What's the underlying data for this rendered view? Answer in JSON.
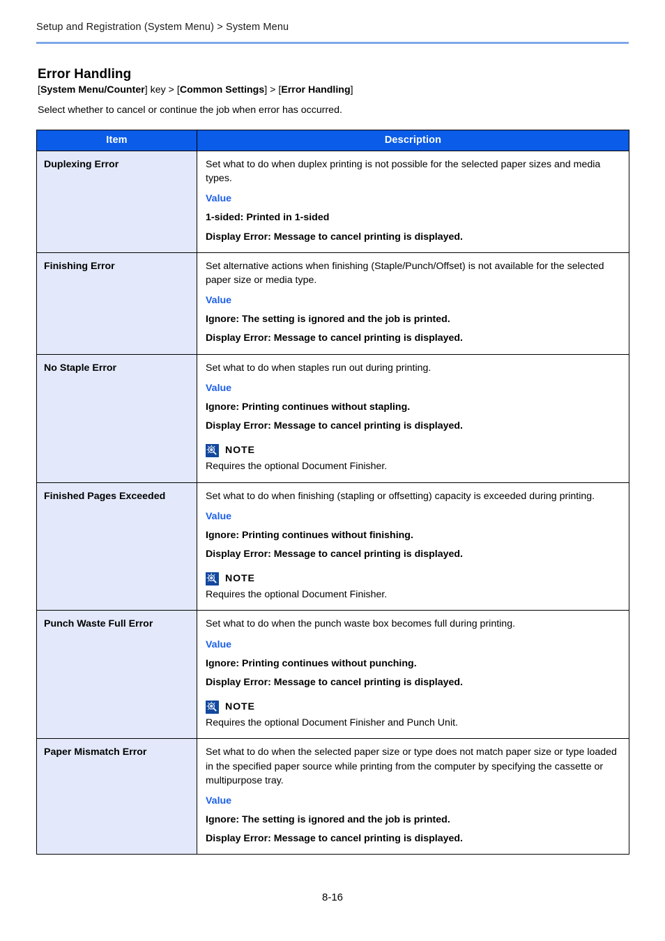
{
  "header": {
    "breadcrumb": "Setup and Registration (System Menu) > System Menu"
  },
  "section": {
    "title": "Error Handling",
    "nav_path": {
      "key_label": "System Menu/Counter",
      "key_suffix": "key",
      "step2": "Common Settings",
      "step3": "Error Handling"
    },
    "intro": "Select whether to cancel or continue the job when error has occurred."
  },
  "table": {
    "columns": [
      "Item",
      "Description"
    ],
    "rows": [
      {
        "item": "Duplexing Error",
        "body": "Set what to do when duplex printing is not possible for the selected paper sizes and media types.",
        "value_label": "Value",
        "values": [
          "1-sided: Printed in 1-sided",
          "Display Error: Message to cancel printing is displayed."
        ],
        "note_label": null,
        "note_body": null
      },
      {
        "item": "Finishing Error",
        "body": "Set alternative actions when finishing (Staple/Punch/Offset) is not available for the selected paper size or media type.",
        "value_label": "Value",
        "values": [
          "Ignore: The setting is ignored and the job is printed.",
          "Display Error: Message to cancel printing is displayed."
        ],
        "note_label": null,
        "note_body": null
      },
      {
        "item": "No Staple Error",
        "body": "Set what to do when staples run out during printing.",
        "value_label": "Value",
        "values": [
          "Ignore: Printing continues without stapling.",
          "Display Error: Message to cancel printing is displayed."
        ],
        "note_label": "NOTE",
        "note_body": "Requires the optional Document Finisher."
      },
      {
        "item": "Finished Pages Exceeded",
        "body": "Set what to do when finishing (stapling or offsetting) capacity is exceeded during printing.",
        "value_label": "Value",
        "values": [
          "Ignore: Printing continues without finishing.",
          "Display Error: Message to cancel printing is displayed."
        ],
        "note_label": "NOTE",
        "note_body": "Requires the optional Document Finisher."
      },
      {
        "item": "Punch Waste Full Error",
        "body": "Set what to do when the punch waste box becomes full during printing.",
        "value_label": "Value",
        "values": [
          "Ignore: Printing continues without punching.",
          "Display Error: Message to cancel printing is displayed."
        ],
        "note_label": "NOTE",
        "note_body": "Requires the optional Document Finisher and Punch Unit."
      },
      {
        "item": "Paper Mismatch Error",
        "body": "Set what to do when the selected paper size or type does not match paper size or type loaded in the specified paper source while printing from the computer by specifying the cassette or multipurpose tray.",
        "value_label": "Value",
        "values": [
          "Ignore: The setting is ignored and the job is printed.",
          "Display Error: Message to cancel printing is displayed."
        ],
        "note_label": null,
        "note_body": null
      }
    ]
  },
  "footer": {
    "page_number": "8-16"
  },
  "colors": {
    "header_blue": "#0B5CE8",
    "rule_blue": "#7FA8E8",
    "item_cell_bg": "#E3E9FA",
    "value_blue": "#1B5FE8",
    "note_icon_blue": "#12489E"
  },
  "icons": {
    "note": "note-magnifier-icon"
  }
}
